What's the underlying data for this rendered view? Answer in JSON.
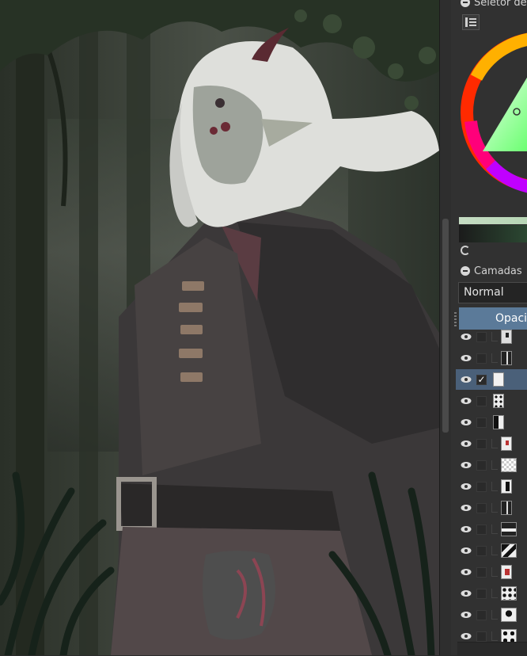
{
  "canvas": {
    "description_name": "artwork-canvas"
  },
  "color_panel": {
    "title": "Seletor de",
    "menu_icon": "list-icon",
    "colors": {
      "foreground": "#b6d6b4",
      "background": "#1d2a20"
    }
  },
  "layers_panel": {
    "title": "Camadas",
    "blend_mode": "Normal",
    "opacity_label": "Opacio",
    "active_color": "#4a6079",
    "layers": [
      {
        "thumb": "mask",
        "checked": false
      },
      {
        "thumb": "line",
        "checked": false
      },
      {
        "thumb": "white",
        "checked": true,
        "active": true
      },
      {
        "thumb": "mask",
        "checked": false
      },
      {
        "thumb": "group",
        "checked": false
      },
      {
        "thumb": "mask",
        "checked": false
      },
      {
        "thumb": "checker",
        "checked": false
      },
      {
        "thumb": "mask",
        "checked": false
      },
      {
        "thumb": "line",
        "checked": false
      },
      {
        "thumb": "bar",
        "checked": false
      },
      {
        "thumb": "mask",
        "checked": false
      },
      {
        "thumb": "mask",
        "checked": false
      },
      {
        "thumb": "mask",
        "checked": false
      },
      {
        "thumb": "mask",
        "checked": false
      },
      {
        "thumb": "mask",
        "checked": false
      }
    ]
  }
}
